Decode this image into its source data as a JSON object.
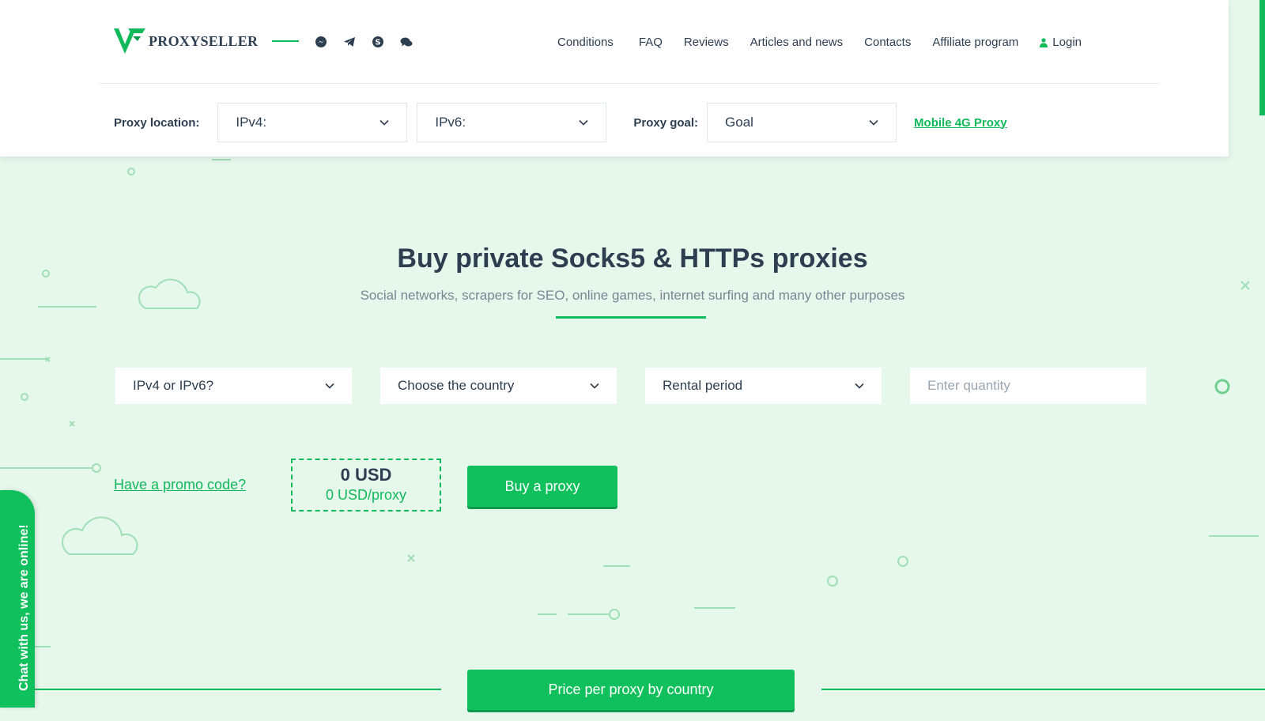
{
  "brand": {
    "name": "PROXYSELLER",
    "accent": "#10b95a"
  },
  "social_icons": [
    "messenger-icon",
    "telegram-icon",
    "skype-icon",
    "chat-bubbles-icon"
  ],
  "nav": {
    "conditions": "Conditions",
    "faq": "FAQ",
    "reviews": "Reviews",
    "articles": "Articles and news",
    "contacts": "Contacts",
    "affiliate": "Affiliate program",
    "login": "Login"
  },
  "filters": {
    "location_label": "Proxy location:",
    "ipv4": "IPv4:",
    "ipv6": "IPv6:",
    "goal_label": "Proxy goal:",
    "goal": "Goal",
    "mobile_link": "Mobile 4G Proxy"
  },
  "hero": {
    "title": "Buy private Socks5 & HTTPs proxies",
    "subtitle": "Social networks, scrapers for SEO, online games, internet surfing and many other purposes"
  },
  "form": {
    "ip_version": "IPv4 or IPv6?",
    "country": "Choose the country",
    "period": "Rental period",
    "quantity_placeholder": "Enter quantity"
  },
  "pricing": {
    "promo": "Have a promo code?",
    "total": "0 USD",
    "per_proxy": "0 USD/proxy",
    "buy": "Buy a proxy"
  },
  "price_by_country": "Price per proxy by country",
  "chat_tab": "Chat with us, we are online!"
}
